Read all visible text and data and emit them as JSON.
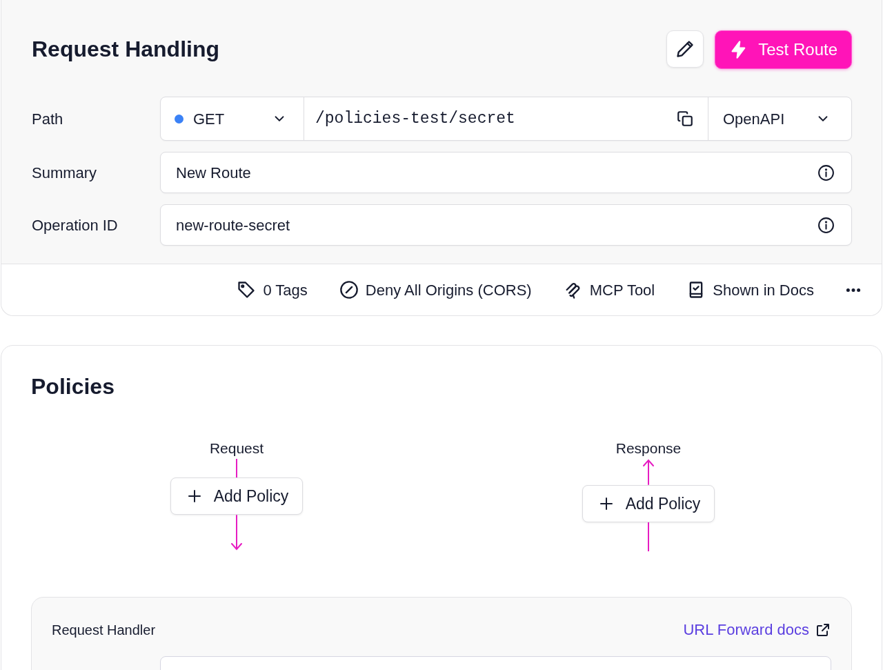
{
  "route": {
    "title": "Request Handling",
    "test_button": "Test Route"
  },
  "fields": [
    {
      "kind": "path",
      "label": "Path",
      "method": "GET",
      "path": "/policies-test/secret",
      "spec": "OpenAPI"
    },
    {
      "kind": "text",
      "label": "Summary",
      "value": "New Route"
    },
    {
      "kind": "text",
      "label": "Operation ID",
      "value": "new-route-secret"
    }
  ],
  "footer_items": [
    {
      "kind": "tag",
      "label": "0 Tags"
    },
    {
      "kind": "cors",
      "label": "Deny All Origins (CORS)"
    },
    {
      "kind": "mcp",
      "label": "MCP Tool"
    },
    {
      "kind": "docs",
      "label": "Shown in Docs"
    }
  ],
  "policies": {
    "title": "Policies",
    "flows": [
      {
        "kind": "request",
        "label": "Request",
        "button": "Add Policy"
      },
      {
        "kind": "response",
        "label": "Response",
        "button": "Add Policy"
      }
    ]
  },
  "handler": {
    "title": "Request Handler",
    "link": "URL Forward docs"
  }
}
